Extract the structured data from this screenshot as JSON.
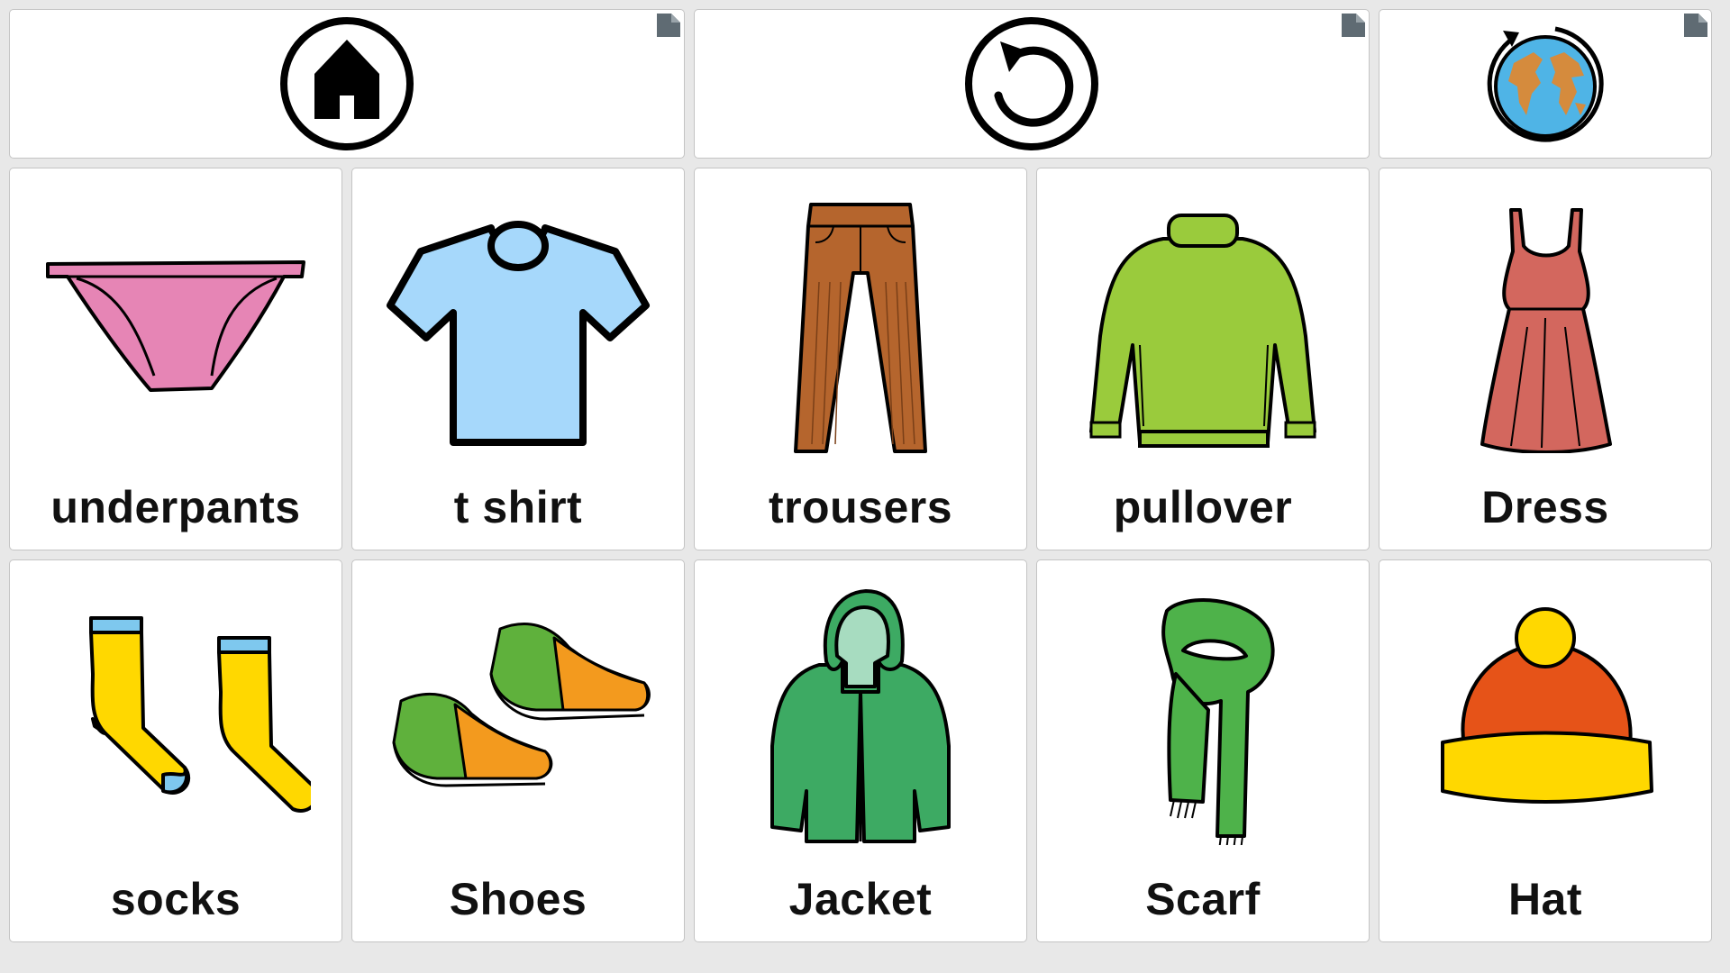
{
  "nav": {
    "home": {
      "icon": "home-icon"
    },
    "back": {
      "icon": "undo-icon"
    },
    "language": {
      "icon": "globe-icon"
    }
  },
  "items": [
    {
      "label": "underpants",
      "icon": "underpants-icon"
    },
    {
      "label": "t shirt",
      "icon": "tshirt-icon"
    },
    {
      "label": "trousers",
      "icon": "trousers-icon"
    },
    {
      "label": "pullover",
      "icon": "pullover-icon"
    },
    {
      "label": "Dress",
      "icon": "dress-icon"
    },
    {
      "label": "socks",
      "icon": "socks-icon"
    },
    {
      "label": "Shoes",
      "icon": "shoes-icon"
    },
    {
      "label": "Jacket",
      "icon": "jacket-icon"
    },
    {
      "label": "Scarf",
      "icon": "scarf-icon"
    },
    {
      "label": "Hat",
      "icon": "hat-icon"
    }
  ],
  "colors": {
    "background": "#e8e8e8",
    "cell": "#ffffff",
    "corner": "#5f6b73"
  }
}
